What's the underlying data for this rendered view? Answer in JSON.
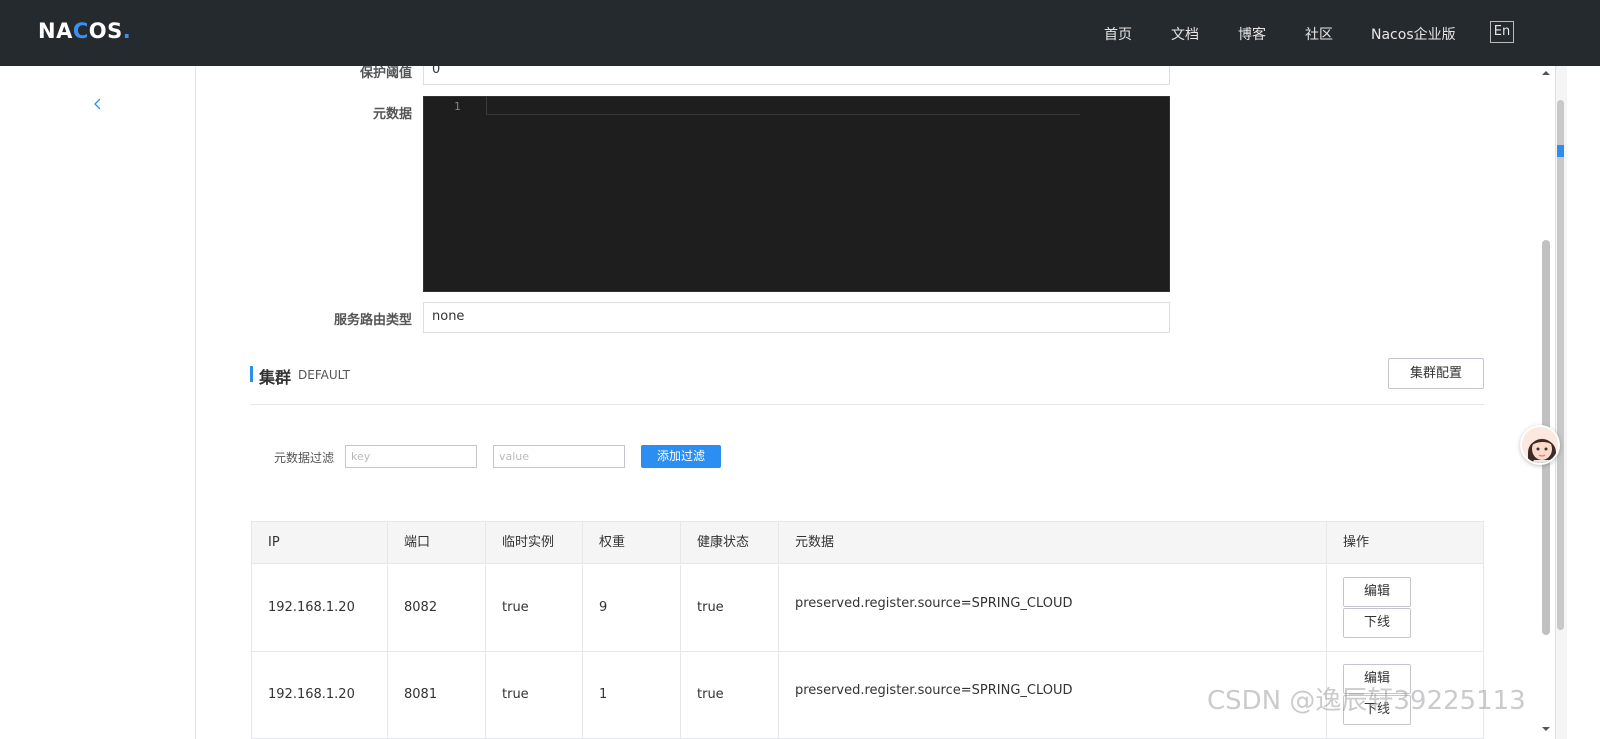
{
  "header": {
    "logo_part1": "NA",
    "logo_part2": "C",
    "logo_part3": "OS",
    "logo_dot": ".",
    "nav": [
      "首页",
      "文档",
      "博客",
      "社区",
      "Nacos企业版"
    ],
    "lang": "En"
  },
  "form": {
    "protect_threshold_label": "保护阈值",
    "protect_threshold_value": "0",
    "metadata_label": "元数据",
    "editor_line_number": "1",
    "route_type_label": "服务路由类型",
    "route_type_value": "none"
  },
  "cluster": {
    "title": "集群",
    "name": "DEFAULT",
    "config_button": "集群配置",
    "filter_label": "元数据过滤",
    "key_placeholder": "key",
    "value_placeholder": "value",
    "add_filter_button": "添加过滤"
  },
  "table": {
    "columns": [
      "IP",
      "端口",
      "临时实例",
      "权重",
      "健康状态",
      "元数据",
      "操作"
    ],
    "rows": [
      {
        "ip": "192.168.1.20",
        "port": "8082",
        "ephemeral": "true",
        "weight": "9",
        "healthy": "true",
        "metadata": "preserved.register.source=SPRING_CLOUD",
        "edit": "编辑",
        "offline": "下线"
      },
      {
        "ip": "192.168.1.20",
        "port": "8081",
        "ephemeral": "true",
        "weight": "1",
        "healthy": "true",
        "metadata": "preserved.register.source=SPRING_CLOUD",
        "edit": "编辑",
        "offline": "下线"
      }
    ]
  },
  "watermark": "CSDN @逸辰轩39225113",
  "colors": {
    "header_bg": "#252a2f",
    "accent": "#2b8ef0"
  }
}
